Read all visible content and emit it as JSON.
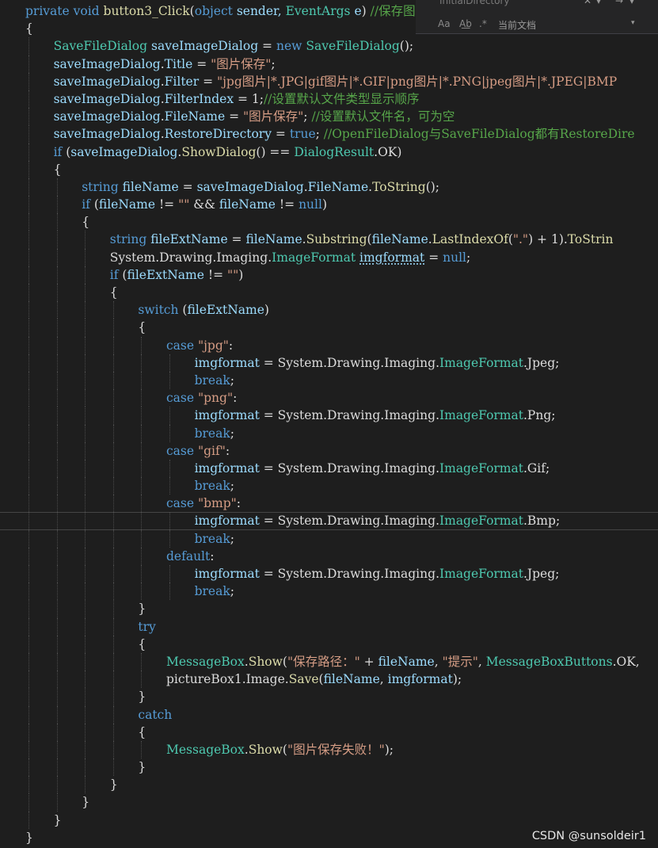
{
  "theme": {
    "background": "#1e1e1e",
    "keyword": "#569cd6",
    "type": "#4ec9b0",
    "method": "#dcdcaa",
    "string": "#d69d85",
    "comment": "#57a64a",
    "text": "#dcdcdc",
    "variable": "#9cdcfe"
  },
  "find_widget": {
    "search_value": "InitialDirectory",
    "close_label": "✕",
    "options_label": "▾",
    "prev_label": "→",
    "next_label": "▾",
    "match_case_label": "Aa",
    "whole_word_label": "A͟b",
    "regex_label": ".*",
    "scope_label": "当前文档",
    "scope_arrow": "▾"
  },
  "code_lines": [
    {
      "indent": 0,
      "tokens": [
        [
          "private ",
          "keyword"
        ],
        [
          "void ",
          "keyword"
        ],
        [
          "button3_Click",
          "method"
        ],
        [
          "(",
          "text"
        ],
        [
          "object ",
          "keyword"
        ],
        [
          "sender, ",
          "variable"
        ],
        [
          "EventArgs ",
          "type"
        ],
        [
          "e",
          "variable"
        ],
        [
          ") ",
          "text"
        ],
        [
          "//保存图片",
          "comment"
        ]
      ]
    },
    {
      "indent": 0,
      "tokens": [
        [
          "{",
          "text"
        ]
      ]
    },
    {
      "indent": 1,
      "tokens": [
        [
          "SaveFileDialog ",
          "type"
        ],
        [
          "saveImageDialog",
          "variable"
        ],
        [
          " = ",
          "text"
        ],
        [
          "new ",
          "keyword"
        ],
        [
          "SaveFileDialog",
          "type"
        ],
        [
          "();",
          "text"
        ]
      ]
    },
    {
      "indent": 1,
      "tokens": [
        [
          "saveImageDialog",
          "variable"
        ],
        [
          ".",
          "text"
        ],
        [
          "Title",
          "variable"
        ],
        [
          " = ",
          "text"
        ],
        [
          "\"图片保存\"",
          "string"
        ],
        [
          ";",
          "text"
        ]
      ]
    },
    {
      "indent": 1,
      "tokens": [
        [
          "saveImageDialog",
          "variable"
        ],
        [
          ".",
          "text"
        ],
        [
          "Filter",
          "variable"
        ],
        [
          " = ",
          "text"
        ],
        [
          "\"jpg图片|*.JPG|gif图片|*.GIF|png图片|*.PNG|jpeg图片|*.JPEG|BMP",
          "string"
        ]
      ]
    },
    {
      "indent": 1,
      "tokens": [
        [
          "saveImageDialog",
          "variable"
        ],
        [
          ".",
          "text"
        ],
        [
          "FilterIndex",
          "variable"
        ],
        [
          " = 1;",
          "text"
        ],
        [
          "//设置默认文件类型显示顺序",
          "comment"
        ]
      ]
    },
    {
      "indent": 1,
      "tokens": [
        [
          "saveImageDialog",
          "variable"
        ],
        [
          ".",
          "text"
        ],
        [
          "FileName",
          "variable"
        ],
        [
          " = ",
          "text"
        ],
        [
          "\"图片保存\"",
          "string"
        ],
        [
          "; ",
          "text"
        ],
        [
          "//设置默认文件名，可为空",
          "comment"
        ]
      ]
    },
    {
      "indent": 1,
      "tokens": [
        [
          "saveImageDialog",
          "variable"
        ],
        [
          ".",
          "text"
        ],
        [
          "RestoreDirectory",
          "variable"
        ],
        [
          " = ",
          "text"
        ],
        [
          "true",
          "keyword"
        ],
        [
          "; ",
          "text"
        ],
        [
          "//OpenFileDialog与SaveFileDialog都有RestoreDire",
          "comment"
        ]
      ]
    },
    {
      "indent": 1,
      "tokens": [
        [
          "if ",
          "keyword"
        ],
        [
          "(",
          "text"
        ],
        [
          "saveImageDialog",
          "variable"
        ],
        [
          ".",
          "text"
        ],
        [
          "ShowDialog",
          "method"
        ],
        [
          "() == ",
          "text"
        ],
        [
          "DialogResult",
          "type"
        ],
        [
          ".OK)",
          "text"
        ]
      ]
    },
    {
      "indent": 1,
      "tokens": [
        [
          "{",
          "text"
        ]
      ]
    },
    {
      "indent": 2,
      "tokens": [
        [
          "string ",
          "keyword"
        ],
        [
          "fileName",
          "variable"
        ],
        [
          " = ",
          "text"
        ],
        [
          "saveImageDialog",
          "variable"
        ],
        [
          ".",
          "text"
        ],
        [
          "FileName",
          "variable"
        ],
        [
          ".",
          "text"
        ],
        [
          "ToString",
          "method"
        ],
        [
          "();",
          "text"
        ]
      ]
    },
    {
      "indent": 2,
      "tokens": [
        [
          "if ",
          "keyword"
        ],
        [
          "(",
          "text"
        ],
        [
          "fileName",
          "variable"
        ],
        [
          " != ",
          "text"
        ],
        [
          "\"\"",
          "string"
        ],
        [
          " && ",
          "text"
        ],
        [
          "fileName",
          "variable"
        ],
        [
          " != ",
          "text"
        ],
        [
          "null",
          "keyword"
        ],
        [
          ")",
          "text"
        ]
      ]
    },
    {
      "indent": 2,
      "tokens": [
        [
          "{",
          "text"
        ]
      ]
    },
    {
      "indent": 3,
      "tokens": [
        [
          "string ",
          "keyword"
        ],
        [
          "fileExtName",
          "variable"
        ],
        [
          " = ",
          "text"
        ],
        [
          "fileName",
          "variable"
        ],
        [
          ".",
          "text"
        ],
        [
          "Substring",
          "method"
        ],
        [
          "(",
          "text"
        ],
        [
          "fileName",
          "variable"
        ],
        [
          ".",
          "text"
        ],
        [
          "LastIndexOf",
          "method"
        ],
        [
          "(",
          "text"
        ],
        [
          "\".\"",
          "string"
        ],
        [
          ") + 1).",
          "text"
        ],
        [
          "ToStrin",
          "method"
        ]
      ]
    },
    {
      "indent": 3,
      "tokens": [
        [
          "System",
          "text"
        ],
        [
          ".",
          "text"
        ],
        [
          "Drawing",
          "text"
        ],
        [
          ".",
          "text"
        ],
        [
          "Imaging",
          "text"
        ],
        [
          ".",
          "text"
        ],
        [
          "ImageFormat ",
          "type"
        ],
        [
          "imgformat",
          "variable",
          "squiggle"
        ],
        [
          " = ",
          "text"
        ],
        [
          "null",
          "keyword"
        ],
        [
          ";",
          "text"
        ]
      ]
    },
    {
      "indent": 3,
      "tokens": [
        [
          "if ",
          "keyword"
        ],
        [
          "(",
          "text"
        ],
        [
          "fileExtName",
          "variable"
        ],
        [
          " != ",
          "text"
        ],
        [
          "\"\"",
          "string"
        ],
        [
          ")",
          "text"
        ]
      ]
    },
    {
      "indent": 3,
      "tokens": [
        [
          "{",
          "text"
        ]
      ]
    },
    {
      "indent": 4,
      "tokens": [
        [
          "switch ",
          "keyword"
        ],
        [
          "(",
          "text"
        ],
        [
          "fileExtName",
          "variable"
        ],
        [
          ")",
          "text"
        ]
      ]
    },
    {
      "indent": 4,
      "tokens": [
        [
          "{",
          "text"
        ]
      ]
    },
    {
      "indent": 5,
      "tokens": [
        [
          "case ",
          "keyword"
        ],
        [
          "\"jpg\"",
          "string"
        ],
        [
          ":",
          "text"
        ]
      ]
    },
    {
      "indent": 6,
      "tokens": [
        [
          "imgformat",
          "variable"
        ],
        [
          " = ",
          "text"
        ],
        [
          "System",
          "text"
        ],
        [
          ".",
          "text"
        ],
        [
          "Drawing",
          "text"
        ],
        [
          ".",
          "text"
        ],
        [
          "Imaging",
          "text"
        ],
        [
          ".",
          "text"
        ],
        [
          "ImageFormat",
          "type"
        ],
        [
          ".",
          "text"
        ],
        [
          "Jpeg",
          "text"
        ],
        [
          ";",
          "text"
        ]
      ]
    },
    {
      "indent": 6,
      "tokens": [
        [
          "break",
          "keyword"
        ],
        [
          ";",
          "text"
        ]
      ]
    },
    {
      "indent": 5,
      "tokens": [
        [
          "case ",
          "keyword"
        ],
        [
          "\"png\"",
          "string"
        ],
        [
          ":",
          "text"
        ]
      ]
    },
    {
      "indent": 6,
      "tokens": [
        [
          "imgformat",
          "variable"
        ],
        [
          " = ",
          "text"
        ],
        [
          "System",
          "text"
        ],
        [
          ".",
          "text"
        ],
        [
          "Drawing",
          "text"
        ],
        [
          ".",
          "text"
        ],
        [
          "Imaging",
          "text"
        ],
        [
          ".",
          "text"
        ],
        [
          "ImageFormat",
          "type"
        ],
        [
          ".",
          "text"
        ],
        [
          "Png",
          "text"
        ],
        [
          ";",
          "text"
        ]
      ]
    },
    {
      "indent": 6,
      "tokens": [
        [
          "break",
          "keyword"
        ],
        [
          ";",
          "text"
        ]
      ]
    },
    {
      "indent": 5,
      "tokens": [
        [
          "case ",
          "keyword"
        ],
        [
          "\"gif\"",
          "string"
        ],
        [
          ":",
          "text"
        ]
      ]
    },
    {
      "indent": 6,
      "tokens": [
        [
          "imgformat",
          "variable"
        ],
        [
          " = ",
          "text"
        ],
        [
          "System",
          "text"
        ],
        [
          ".",
          "text"
        ],
        [
          "Drawing",
          "text"
        ],
        [
          ".",
          "text"
        ],
        [
          "Imaging",
          "text"
        ],
        [
          ".",
          "text"
        ],
        [
          "ImageFormat",
          "type"
        ],
        [
          ".",
          "text"
        ],
        [
          "Gif",
          "text"
        ],
        [
          ";",
          "text"
        ]
      ]
    },
    {
      "indent": 6,
      "tokens": [
        [
          "break",
          "keyword"
        ],
        [
          ";",
          "text"
        ]
      ]
    },
    {
      "indent": 5,
      "tokens": [
        [
          "case ",
          "keyword"
        ],
        [
          "\"bmp\"",
          "string"
        ],
        [
          ":",
          "text"
        ]
      ]
    },
    {
      "indent": 6,
      "current": true,
      "tokens": [
        [
          "imgformat",
          "variable"
        ],
        [
          " = ",
          "text"
        ],
        [
          "System",
          "text"
        ],
        [
          ".",
          "text"
        ],
        [
          "Drawing",
          "text"
        ],
        [
          ".",
          "text"
        ],
        [
          "Imaging",
          "text"
        ],
        [
          ".",
          "text"
        ],
        [
          "ImageFormat",
          "type"
        ],
        [
          ".",
          "text"
        ],
        [
          "Bmp",
          "text"
        ],
        [
          ";",
          "text"
        ]
      ]
    },
    {
      "indent": 6,
      "tokens": [
        [
          "break",
          "keyword"
        ],
        [
          ";",
          "text"
        ]
      ]
    },
    {
      "indent": 5,
      "tokens": [
        [
          "default",
          "keyword"
        ],
        [
          ":",
          "text"
        ]
      ]
    },
    {
      "indent": 6,
      "tokens": [
        [
          "imgformat",
          "variable"
        ],
        [
          " = ",
          "text"
        ],
        [
          "System",
          "text"
        ],
        [
          ".",
          "text"
        ],
        [
          "Drawing",
          "text"
        ],
        [
          ".",
          "text"
        ],
        [
          "Imaging",
          "text"
        ],
        [
          ".",
          "text"
        ],
        [
          "ImageFormat",
          "type"
        ],
        [
          ".",
          "text"
        ],
        [
          "Jpeg",
          "text"
        ],
        [
          ";",
          "text"
        ]
      ]
    },
    {
      "indent": 6,
      "tokens": [
        [
          "break",
          "keyword"
        ],
        [
          ";",
          "text"
        ]
      ]
    },
    {
      "indent": 4,
      "tokens": [
        [
          "}",
          "text"
        ]
      ]
    },
    {
      "indent": 4,
      "tokens": [
        [
          "try",
          "keyword"
        ]
      ]
    },
    {
      "indent": 4,
      "tokens": [
        [
          "{",
          "text"
        ]
      ]
    },
    {
      "indent": 5,
      "tokens": [
        [
          "MessageBox",
          "type"
        ],
        [
          ".",
          "text"
        ],
        [
          "Show",
          "method"
        ],
        [
          "(",
          "text"
        ],
        [
          "\"保存路径：\"",
          "string"
        ],
        [
          " + ",
          "text"
        ],
        [
          "fileName",
          "variable"
        ],
        [
          ", ",
          "text"
        ],
        [
          "\"提示\"",
          "string"
        ],
        [
          ", ",
          "text"
        ],
        [
          "MessageBoxButtons",
          "type"
        ],
        [
          ".OK,",
          "text"
        ]
      ]
    },
    {
      "indent": 5,
      "tokens": [
        [
          "pictureBox1",
          "text"
        ],
        [
          ".",
          "text"
        ],
        [
          "Image",
          "text"
        ],
        [
          ".",
          "text"
        ],
        [
          "Save",
          "method"
        ],
        [
          "(",
          "text"
        ],
        [
          "fileName",
          "variable"
        ],
        [
          ", ",
          "text"
        ],
        [
          "imgformat",
          "variable"
        ],
        [
          ");",
          "text"
        ]
      ]
    },
    {
      "indent": 4,
      "tokens": [
        [
          "}",
          "text"
        ]
      ]
    },
    {
      "indent": 4,
      "tokens": [
        [
          "catch",
          "keyword"
        ]
      ]
    },
    {
      "indent": 4,
      "tokens": [
        [
          "{",
          "text"
        ]
      ]
    },
    {
      "indent": 5,
      "tokens": [
        [
          "MessageBox",
          "type"
        ],
        [
          ".",
          "text"
        ],
        [
          "Show",
          "method"
        ],
        [
          "(",
          "text"
        ],
        [
          "\"图片保存失败！\"",
          "string"
        ],
        [
          ");",
          "text"
        ]
      ]
    },
    {
      "indent": 4,
      "tokens": [
        [
          "}",
          "text"
        ]
      ]
    },
    {
      "indent": 3,
      "tokens": [
        [
          "}",
          "text"
        ]
      ]
    },
    {
      "indent": 2,
      "tokens": [
        [
          "}",
          "text"
        ]
      ]
    },
    {
      "indent": 1,
      "tokens": [
        [
          "}",
          "text"
        ]
      ]
    },
    {
      "indent": 0,
      "tokens": [
        [
          "}",
          "text"
        ]
      ]
    }
  ],
  "watermark": "CSDN @sunsoldeir1"
}
